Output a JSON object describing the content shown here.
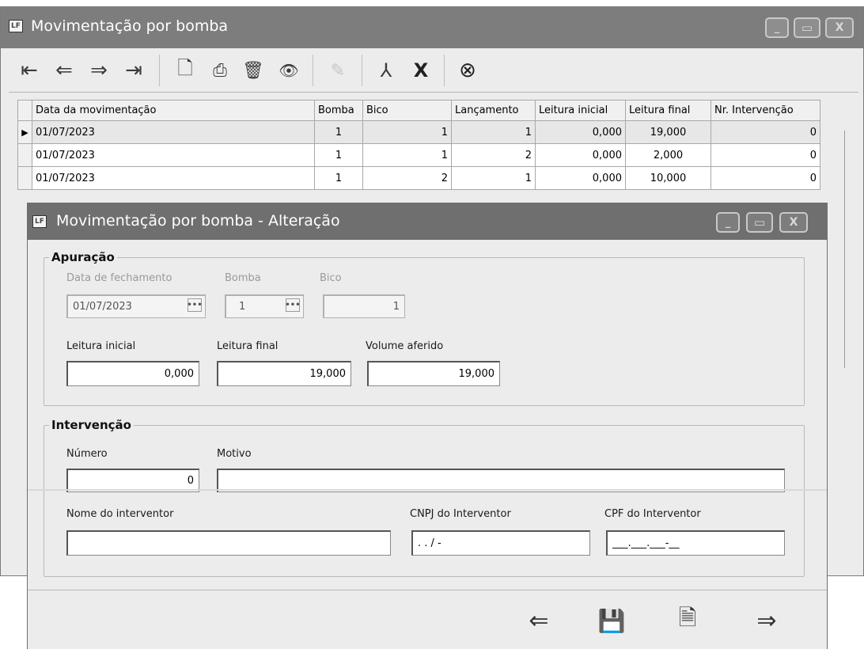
{
  "back_window": {
    "icon_text": "LF",
    "title": "Movimentação por bomba",
    "controls": {
      "minimize": "_",
      "maximize": "▭",
      "close": "X"
    },
    "toolbar": {
      "first": "⇤",
      "prev": "⇐",
      "next": "⇒",
      "last": "⇥",
      "new": "🗋",
      "duplicate": "⎙",
      "delete": "🗑",
      "view": "👁",
      "edit": "✎",
      "pdf": "⅄",
      "excel": "X",
      "cancel": "⊗"
    },
    "grid": {
      "columns": [
        "Data da movimentação",
        "Bomba",
        "Bico",
        "Lançamento",
        "Leitura inicial",
        "Leitura final",
        "Nr. Intervenção"
      ],
      "rows": [
        {
          "date": "01/07/2023",
          "bomba": "1",
          "bico": "1",
          "lancamento": "1",
          "leitura_inicial": "0,000",
          "leitura_final": "19,000",
          "nr_intervencao": "0"
        },
        {
          "date": "01/07/2023",
          "bomba": "1",
          "bico": "1",
          "lancamento": "2",
          "leitura_inicial": "0,000",
          "leitura_final": "2,000",
          "nr_intervencao": "0"
        },
        {
          "date": "01/07/2023",
          "bomba": "1",
          "bico": "2",
          "lancamento": "1",
          "leitura_inicial": "0,000",
          "leitura_final": "10,000",
          "nr_intervencao": "0"
        }
      ],
      "selected_row_marker": "▶"
    }
  },
  "dialog": {
    "icon_text": "LF",
    "title": "Movimentação por bomba - Alteração",
    "controls": {
      "minimize": "_",
      "maximize": "▭",
      "close": "X"
    },
    "apuracao": {
      "legend": "Apuração",
      "data_fechamento": {
        "label": "Data de fechamento",
        "value": "01/07/2023"
      },
      "bomba": {
        "label": "Bomba",
        "value": "1"
      },
      "bico": {
        "label": "Bico",
        "value": "1"
      },
      "leitura_inicial": {
        "label": "Leitura inicial",
        "value": "0,000"
      },
      "leitura_final": {
        "label": "Leitura final",
        "value": "19,000"
      },
      "volume_aferido": {
        "label": "Volume aferido",
        "value": "19,000"
      },
      "ellipsis": "•••"
    },
    "intervencao": {
      "legend": "Intervenção",
      "numero": {
        "label": "Número",
        "value": "0"
      },
      "motivo": {
        "label": "Motivo",
        "value": ""
      },
      "nome_interventor": {
        "label": "Nome do interventor",
        "value": ""
      },
      "cnpj_interventor": {
        "label": "CNPJ do Interventor",
        "value": " .   .   /   -"
      },
      "cpf_interventor": {
        "label": "CPF do Interventor",
        "value": "___.___.___-__"
      }
    },
    "footer": {
      "prev": "⇐",
      "save": "💾",
      "cancel_edit": "🗎",
      "next": "⇒"
    }
  }
}
